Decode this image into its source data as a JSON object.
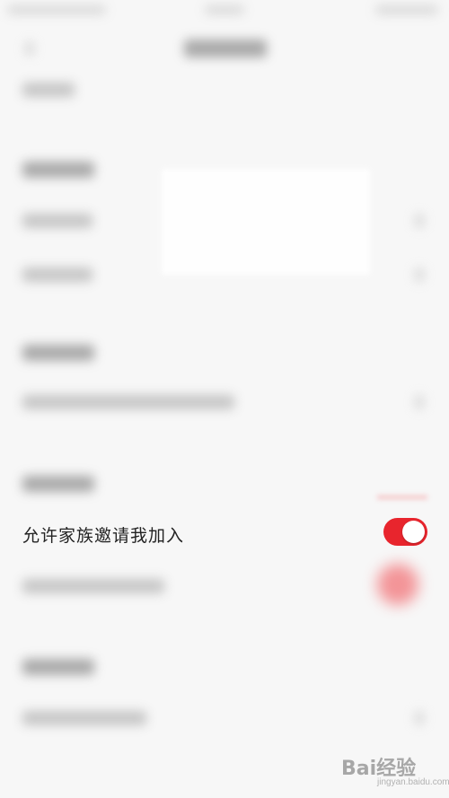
{
  "setting": {
    "label": "允许家族邀请我加入",
    "enabled": true
  },
  "watermark": {
    "main": "Bai经验",
    "sub": "jingyan.baidu.com"
  },
  "colors": {
    "accent": "#e8252d",
    "background": "#f7f7f7",
    "text": "#222222"
  }
}
